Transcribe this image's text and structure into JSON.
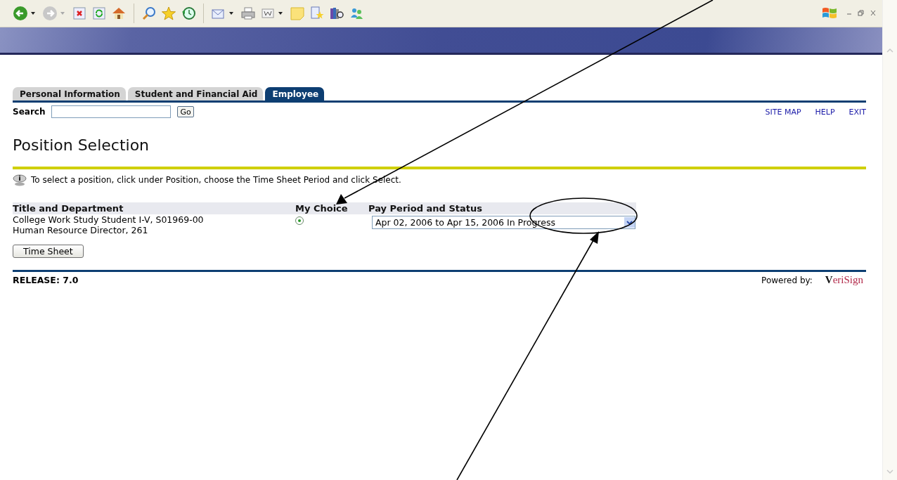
{
  "tabs": [
    {
      "label": "Personal Information",
      "selected": false
    },
    {
      "label": "Student and Financial Aid",
      "selected": false
    },
    {
      "label": "Employee",
      "selected": true
    }
  ],
  "search": {
    "label": "Search",
    "button": "Go"
  },
  "links": [
    "SITE MAP",
    "HELP",
    "EXIT"
  ],
  "title": "Position Selection",
  "instruction": "To select a position, click under Position, choose the Time Sheet Period and click Select.",
  "table": {
    "columns": [
      "Title and Department",
      "My Choice",
      "Pay Period and Status"
    ],
    "rows": [
      {
        "title": "College Work Study Student I-V, S01969-00",
        "department": "Human Resource Director, 261",
        "selected": true,
        "period": "Apr 02, 2006 to Apr 15, 2006 In Progress"
      }
    ]
  },
  "button": "Time Sheet",
  "release": "RELEASE: 7.0",
  "powered_by": "Powered by:",
  "logo": {
    "first": "V",
    "rest": "eriSign"
  }
}
